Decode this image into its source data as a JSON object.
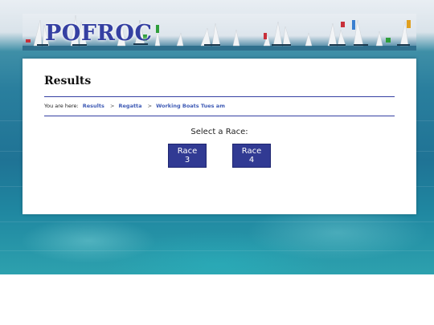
{
  "site": {
    "logo_text": "POFROC"
  },
  "page": {
    "title": "Results"
  },
  "breadcrumb": {
    "prefix": "You are here:",
    "items": [
      "Results",
      "Regatta",
      "Working Boats Tues am"
    ],
    "separator": ">"
  },
  "race_selector": {
    "prompt": "Select a Race:",
    "buttons": [
      "Race 3",
      "Race 4"
    ]
  },
  "colors": {
    "accent": "#313a93",
    "logo": "#3540a2",
    "link": "#3f5bb5",
    "sea": "#1f7395"
  }
}
